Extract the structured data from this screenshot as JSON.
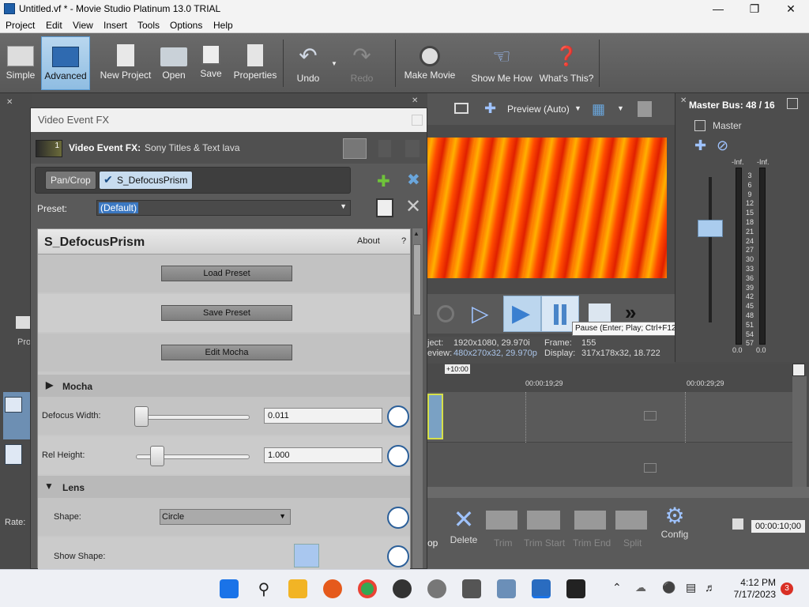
{
  "window": {
    "title": "Untitled.vf * - Movie Studio Platinum 13.0 TRIAL"
  },
  "menu": [
    "Project",
    "Edit",
    "View",
    "Insert",
    "Tools",
    "Options",
    "Help"
  ],
  "toolbar": {
    "simple": "Simple",
    "advanced": "Advanced",
    "new_project": "New Project",
    "open": "Open",
    "save": "Save",
    "properties": "Properties",
    "undo": "Undo",
    "redo": "Redo",
    "make_movie": "Make Movie",
    "show_me_how": "Show Me How",
    "whats_this": "What's This?"
  },
  "fx_window": {
    "title": "Video Event FX",
    "event_label": "Video Event FX:",
    "event_name": "Sony Titles & Text lava",
    "event_index": "1",
    "chain": [
      "Pan/Crop",
      "S_DefocusPrism"
    ],
    "preset_label": "Preset:",
    "preset_value": "(Default)",
    "plugin_name": "S_DefocusPrism",
    "about": "About",
    "help": "?",
    "load_preset": "Load Preset",
    "save_preset": "Save Preset",
    "edit_mocha": "Edit Mocha",
    "section_mocha": "Mocha",
    "defocus_width_label": "Defocus Width:",
    "defocus_width_value": "0.011",
    "rel_height_label": "Rel Height:",
    "rel_height_value": "1.000",
    "section_lens": "Lens",
    "shape_label": "Shape:",
    "shape_value": "Circle",
    "show_shape_label": "Show Shape:"
  },
  "preview": {
    "mode": "Preview (Auto)",
    "tooltip": "Pause (Enter; Play; Ctrl+F12)",
    "project_label": "ject:",
    "project_value": "1920x1080, 29.970i",
    "preview_label": "eview:",
    "preview_value": "480x270x32, 29.970p",
    "frame_label": "Frame:",
    "frame_value": "155",
    "display_label": "Display:",
    "display_value": "317x178x32, 18.722"
  },
  "timeline": {
    "offset": "+10:00",
    "t1": "00:00:19;29",
    "t2": "00:00:29;29",
    "time_readout": "00:00:10;00"
  },
  "bottom": {
    "delete": "Delete",
    "trim": "Trim",
    "trim_start": "Trim Start",
    "trim_end": "Trim End",
    "split": "Split",
    "config": "Config",
    "left_text": "op"
  },
  "left": {
    "rate": "Rate:",
    "pro": "Pro"
  },
  "master": {
    "title": "Master Bus: 48 / 16",
    "label": "Master",
    "inf_left": "-Inf.",
    "inf_right": "-Inf.",
    "scale": [
      "3",
      "6",
      "9",
      "12",
      "15",
      "18",
      "21",
      "24",
      "27",
      "30",
      "33",
      "36",
      "39",
      "42",
      "45",
      "48",
      "51",
      "54",
      "57"
    ],
    "floor_left": "0.0",
    "floor_right": "0.0"
  },
  "taskbar": {
    "time": "4:12 PM",
    "date": "7/17/2023",
    "badge": "3"
  },
  "colors": {
    "accent": "#2b5f99",
    "active": "#8fbde2"
  }
}
